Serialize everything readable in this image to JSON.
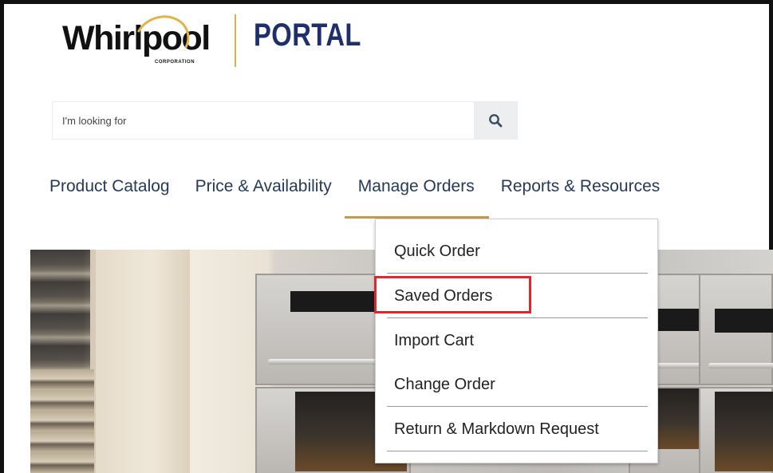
{
  "logo": {
    "brand": "Whirlpool",
    "subtext": "CORPORATION",
    "portal": "PORTAL"
  },
  "search": {
    "placeholder": "I'm looking for",
    "icon": "search-icon"
  },
  "nav": {
    "items": [
      {
        "label": "Product Catalog"
      },
      {
        "label": "Price & Availability"
      },
      {
        "label": "Manage Orders"
      },
      {
        "label": "Reports & Resources"
      }
    ],
    "active": "Manage Orders"
  },
  "dropdown": {
    "items": [
      {
        "label": "Quick Order"
      },
      {
        "label": "Saved Orders"
      },
      {
        "label": "Import Cart"
      },
      {
        "label": "Change Order"
      },
      {
        "label": "Return & Markdown Request"
      }
    ],
    "highlighted": "Saved Orders"
  },
  "colors": {
    "nav_text": "#263a57",
    "accent_underline": "#cf9740",
    "portal_text": "#1f2f6c",
    "highlight": "#e8232b"
  }
}
